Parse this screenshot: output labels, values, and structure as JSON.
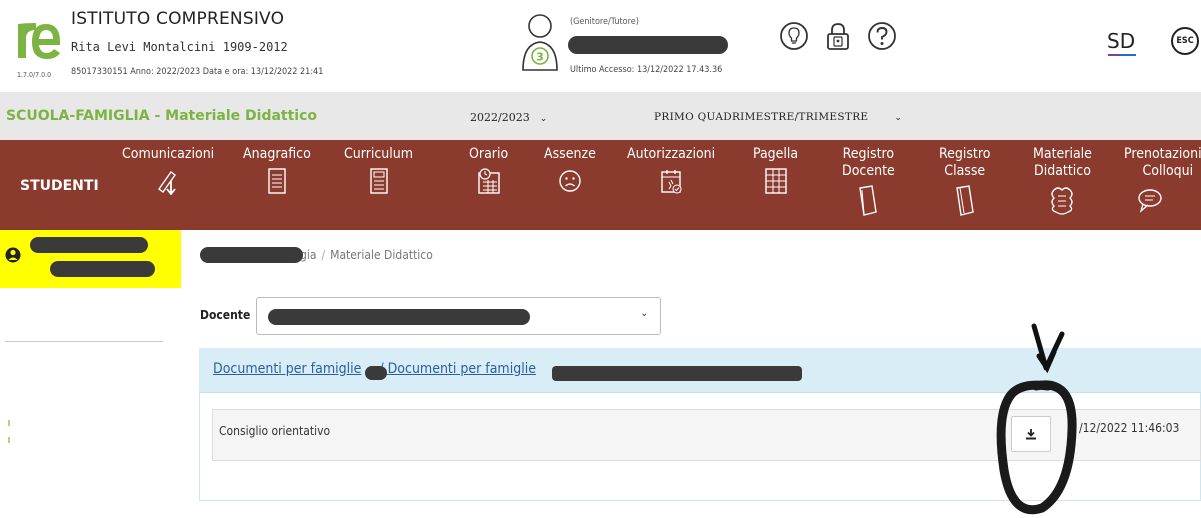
{
  "header": {
    "school_name": "ISTITUTO COMPRENSIVO",
    "school_subtitle": "Rita Levi Montalcini 1909-2012",
    "version": "1.7.0/7.0.0",
    "meta": "85017330151   Anno: 2022/2023   Data e ora: 13/12/2022 21:41",
    "avatar_count": "3",
    "role": "(Genitore/Tutore)",
    "last_access": "Ultimo Accesso: 13/12/2022 17.43.36",
    "icons": [
      "lightbulb-icon",
      "lock-icon",
      "help-icon"
    ],
    "brand_logo_text": "SD",
    "exit_label": "ESC"
  },
  "subbar": {
    "section_title": "SCUOLA-FAMIGLIA - Materiale Didattico",
    "year": "2022/2023",
    "period": "PRIMO QUADRIMESTRE/TRIMESTRE"
  },
  "nav": {
    "students": "STUDENTI",
    "items": [
      {
        "label": "Comunicazioni",
        "label2": "",
        "icon": "communications-icon"
      },
      {
        "label": "Anagrafico",
        "label2": "",
        "icon": "registry-icon"
      },
      {
        "label": "Curriculum",
        "label2": "",
        "icon": "curriculum-icon"
      },
      {
        "label": "Orario",
        "label2": "",
        "icon": "timetable-icon"
      },
      {
        "label": "Assenze",
        "label2": "",
        "icon": "absences-icon"
      },
      {
        "label": "Autorizzazioni",
        "label2": "",
        "icon": "authorizations-icon"
      },
      {
        "label": "Pagella",
        "label2": "",
        "icon": "report-card-icon"
      },
      {
        "label": "Registro",
        "label2": "Docente",
        "icon": "teacher-register-icon"
      },
      {
        "label": "Registro",
        "label2": "Classe",
        "icon": "class-register-icon"
      },
      {
        "label": "Materiale",
        "label2": "Didattico",
        "icon": "teaching-material-icon"
      },
      {
        "label": "Prenotazioni",
        "label2": "Colloqui",
        "icon": "meetings-icon"
      }
    ]
  },
  "breadcrumb": {
    "parent_visible": "gia",
    "separator": "/",
    "current": "Materiale Didattico"
  },
  "filter": {
    "docente_label": "Docente"
  },
  "folder": {
    "path_part1": "Documenti per famiglie",
    "path_sep": "/",
    "path_part2": "Documenti per famiglie"
  },
  "documents": [
    {
      "title": "Consiglio orientativo",
      "date": "/12/2022 11:46:03"
    }
  ],
  "colors": {
    "nav_background": "#8b3a2e",
    "section_title": "#7cb342",
    "student_highlight": "#ffff00",
    "folder_header": "#d9edf7",
    "link": "#2b5fa5"
  }
}
